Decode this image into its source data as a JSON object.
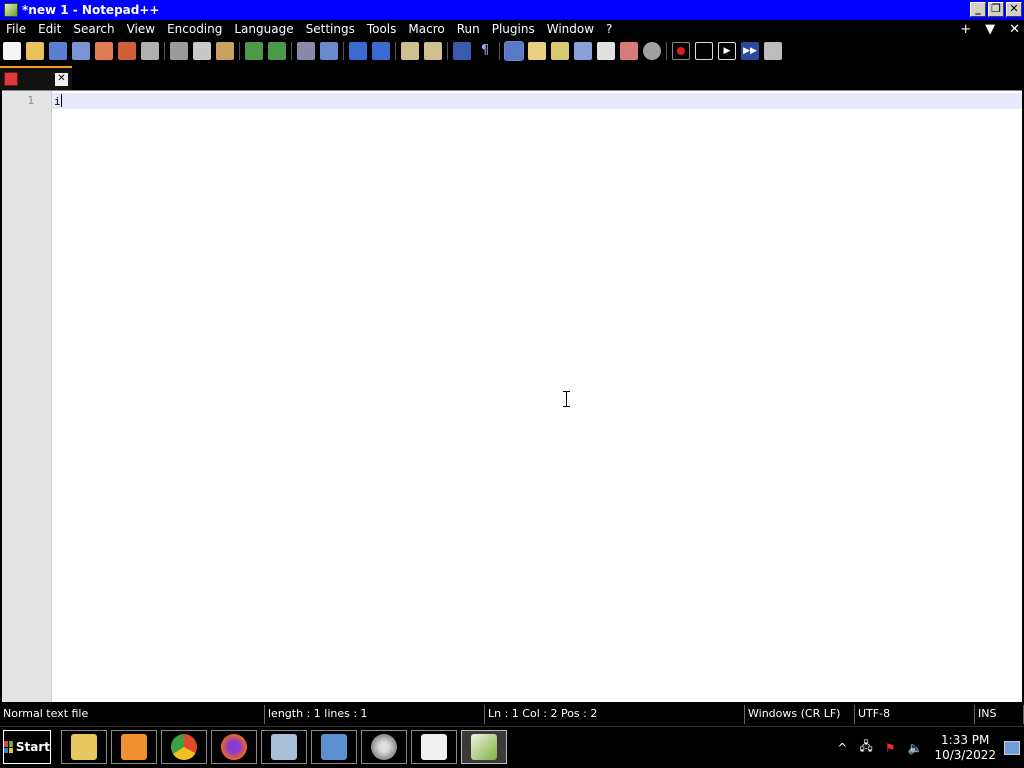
{
  "window": {
    "title": "*new 1 - Notepad++",
    "controls": {
      "minimize": "_",
      "restore": "❐",
      "close": "✕"
    }
  },
  "menu": {
    "items": [
      "File",
      "Edit",
      "Search",
      "View",
      "Encoding",
      "Language",
      "Settings",
      "Tools",
      "Macro",
      "Run",
      "Plugins",
      "Window",
      "?"
    ],
    "right": {
      "add": "+",
      "dropdown": "▼",
      "close": "✕"
    }
  },
  "toolbar": {
    "icons": [
      "new-file-icon",
      "open-file-icon",
      "save-icon",
      "save-all-icon",
      "close-icon",
      "close-all-icon",
      "print-icon",
      "cut-icon",
      "copy-icon",
      "paste-icon",
      "undo-icon",
      "redo-icon",
      "find-icon",
      "replace-icon",
      "zoom-in-icon",
      "zoom-out-icon",
      "sync-vertical-icon",
      "sync-horizontal-icon",
      "word-wrap-icon",
      "show-all-chars-icon",
      "indent-guide-icon",
      "udl-icon",
      "doc-map-icon",
      "function-list-icon",
      "folder-workspace-icon",
      "monitoring-icon",
      "record-macro-icon",
      "stop-macro-icon",
      "play-macro-icon",
      "run-macro-multiple-icon",
      "save-macro-icon"
    ]
  },
  "tab": {
    "name": ""
  },
  "editor": {
    "line_numbers": [
      "1"
    ],
    "lines": [
      "i"
    ]
  },
  "statusbar": {
    "file_type": "Normal text file",
    "length_lines": "length : 1    lines : 1",
    "position": "Ln : 1    Col : 2    Pos : 2",
    "eol": "Windows (CR LF)",
    "encoding": "UTF-8",
    "mode": "INS"
  },
  "taskbar": {
    "start_label": "Start",
    "apps": [
      "file-explorer-icon",
      "media-player-icon",
      "chrome-icon",
      "firefox-icon",
      "documents-icon",
      "control-panel-icon",
      "settings-gear-icon",
      "solitaire-icon",
      "notepadpp-icon"
    ],
    "tray": {
      "chevron": "^",
      "time": "1:33 PM",
      "date": "10/3/2022"
    }
  }
}
